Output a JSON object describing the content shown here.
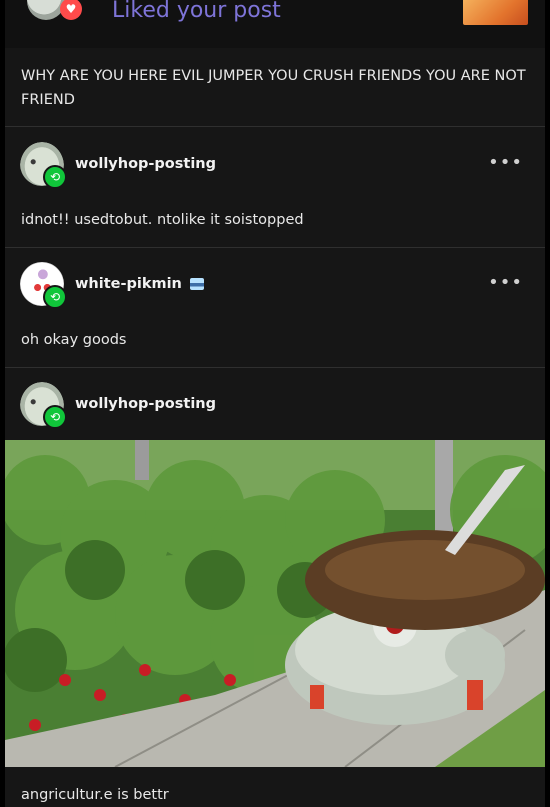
{
  "notification": {
    "label": "Liked your post",
    "heart_icon": "heart-icon"
  },
  "posts": [
    {
      "text": "WHY ARE YOU HERE EVIL JUMPER YOU CRUSH FRIENDS YOU ARE NOT FRIEND"
    },
    {
      "username": "wollyhop-posting",
      "text": "idnot!!   usedtobut. ntolike it soistopped",
      "menu": "•••"
    },
    {
      "username": "white-pikmin",
      "text": "oh okay goods",
      "menu": "•••"
    },
    {
      "username": "wollyhop-posting",
      "caption": "angricultur.e is bettr"
    }
  ],
  "colors": {
    "background": "#161616",
    "reblog_badge": "#10c63a",
    "notification_text": "#7e74d8",
    "divider": "#2f2f2f"
  },
  "icons": [
    "heart-icon",
    "reblog-icon",
    "more-options-icon",
    "blue-badge-icon"
  ]
}
